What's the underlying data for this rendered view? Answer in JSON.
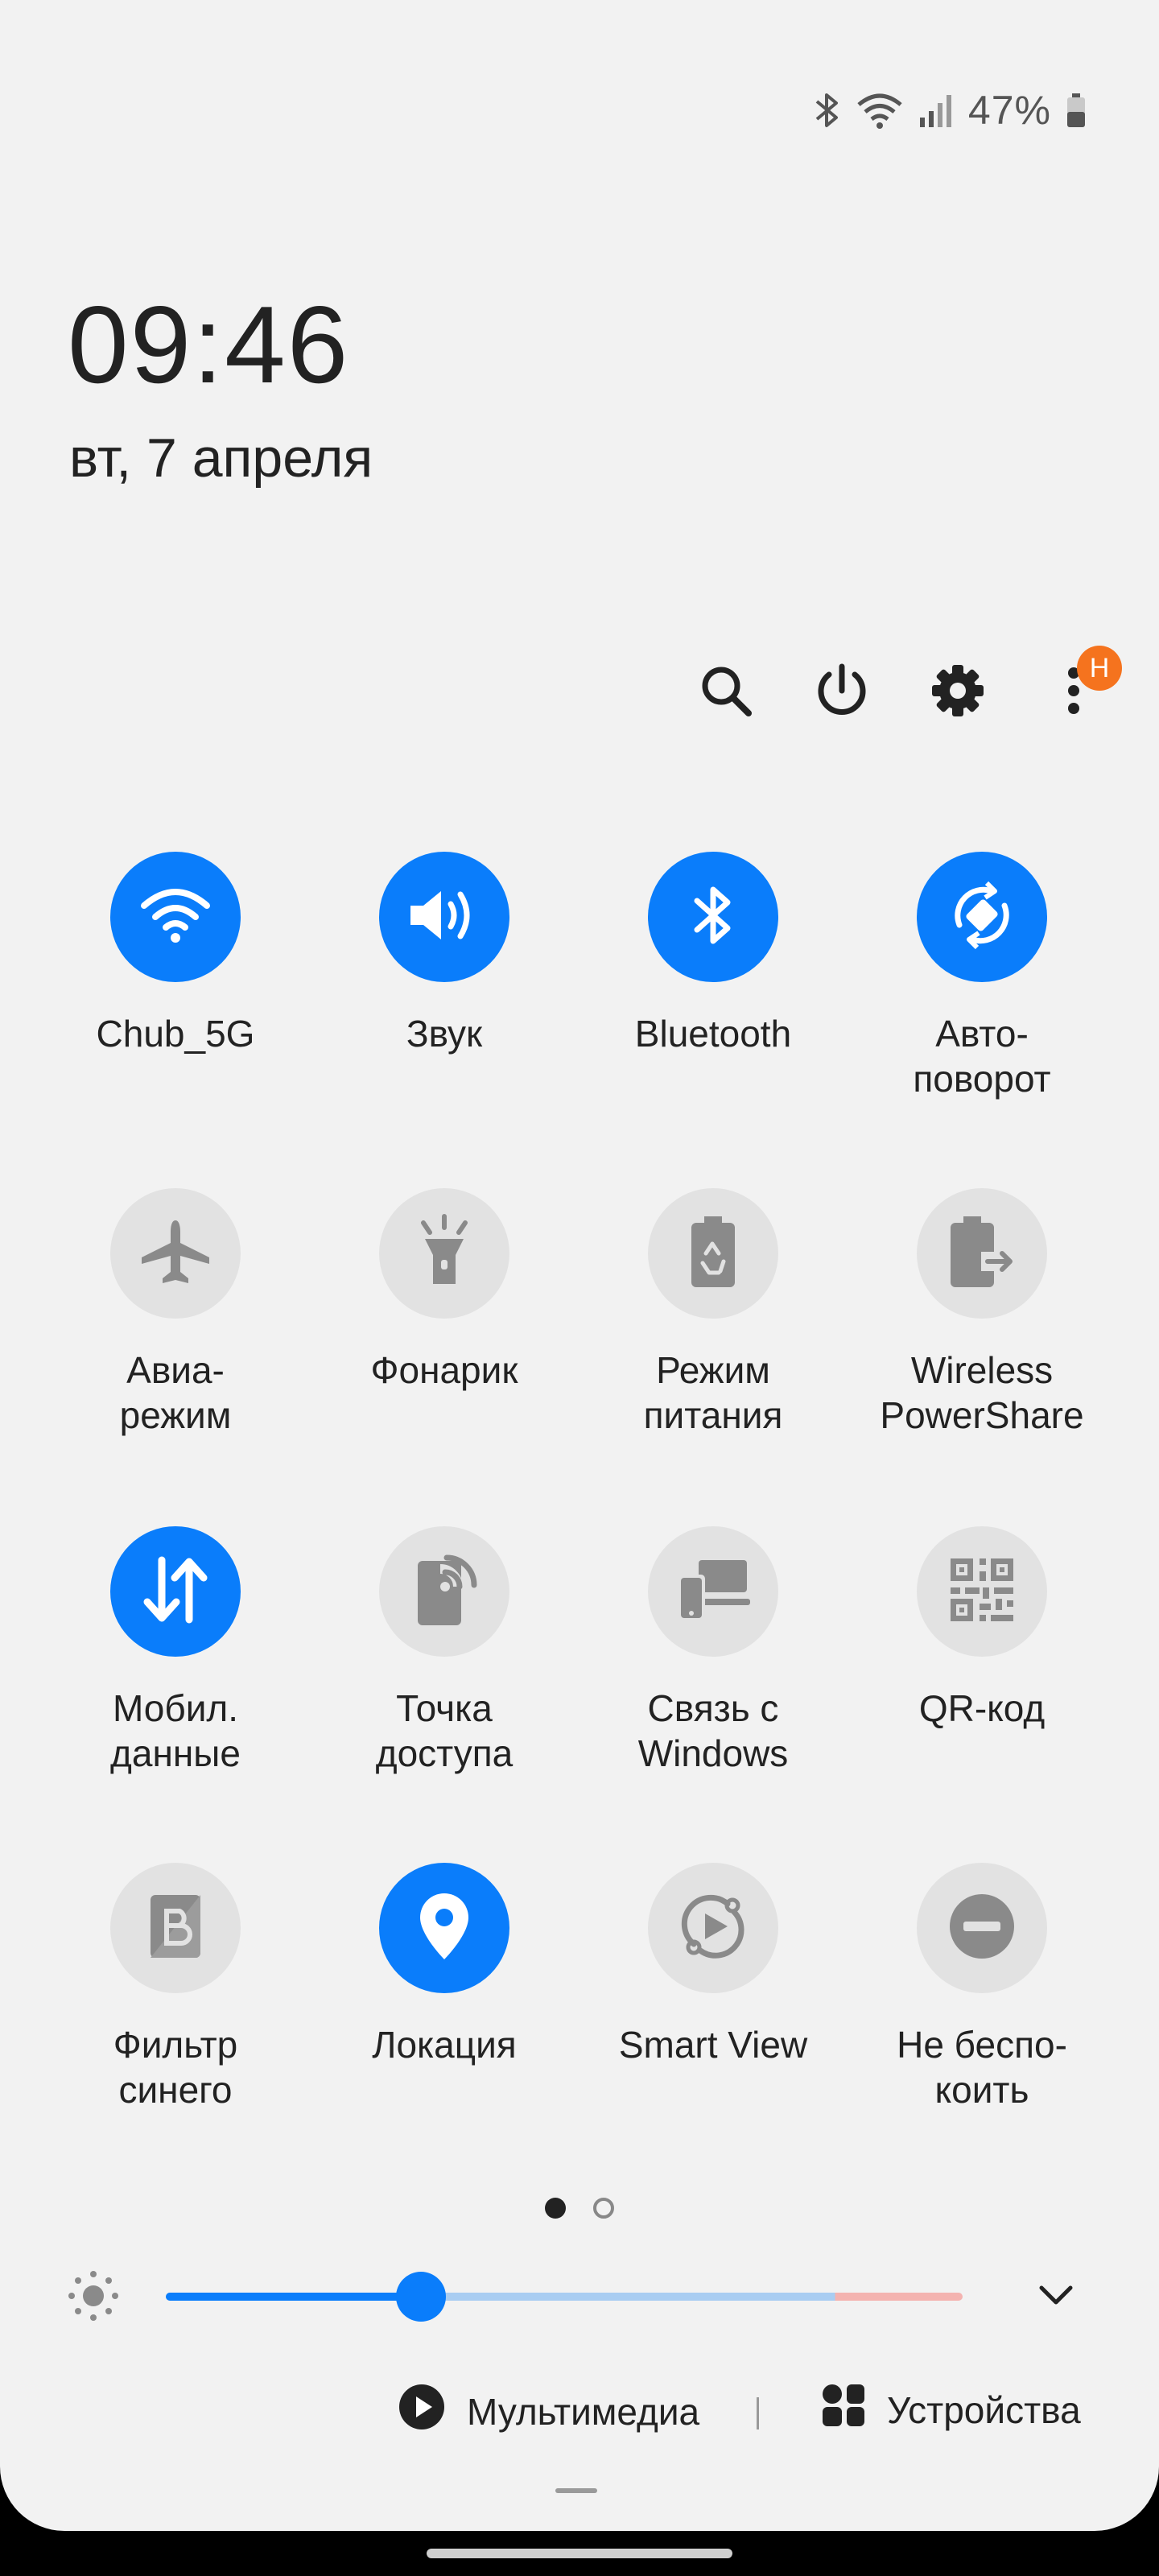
{
  "status": {
    "battery_percent": "47%"
  },
  "clock": {
    "time": "09:46",
    "date": "вт, 7 апреля"
  },
  "header": {
    "search_icon": "search-icon",
    "power_icon": "power-icon",
    "settings_icon": "gear-icon",
    "more_icon": "more-vertical-icon",
    "badge": "Н"
  },
  "tiles": [
    {
      "label": "Chub_5G",
      "state": "on",
      "icon": "wifi-icon"
    },
    {
      "label": "Звук",
      "state": "on",
      "icon": "sound-icon"
    },
    {
      "label": "Bluetooth",
      "state": "on",
      "icon": "bluetooth-icon"
    },
    {
      "label": "Авто-\nповорот",
      "state": "on",
      "icon": "auto-rotate-icon"
    },
    {
      "label": "Авиа-\nрежим",
      "state": "off",
      "icon": "airplane-icon"
    },
    {
      "label": "Фонарик",
      "state": "off",
      "icon": "flashlight-icon"
    },
    {
      "label": "Режим\nпитания",
      "state": "off",
      "icon": "power-mode-icon"
    },
    {
      "label": "Wireless\nPowerShare",
      "state": "off",
      "icon": "powershare-icon"
    },
    {
      "label": "Мобил.\nданные",
      "state": "on",
      "icon": "mobile-data-icon"
    },
    {
      "label": "Точка\nдоступа",
      "state": "off",
      "icon": "hotspot-icon"
    },
    {
      "label": "Связь с\nWindows",
      "state": "off",
      "icon": "link-windows-icon"
    },
    {
      "label": "QR-код",
      "state": "off",
      "icon": "qr-code-icon"
    },
    {
      "label": "Фильтр\nсинего",
      "state": "off",
      "icon": "blue-filter-icon"
    },
    {
      "label": "Локация",
      "state": "on",
      "icon": "location-icon"
    },
    {
      "label": "Smart View",
      "state": "off",
      "icon": "smart-view-icon"
    },
    {
      "label": "Не беспо-\nкоить",
      "state": "off",
      "icon": "do-not-disturb-icon"
    }
  ],
  "pager": {
    "current_page": 1,
    "total_pages": 2
  },
  "brightness": {
    "level": 0.32
  },
  "bottom": {
    "media_label": "Мультимедиа",
    "devices_label": "Устройства"
  },
  "colors": {
    "accent": "#0a7dfb",
    "badge": "#f5731e",
    "panel_bg": "#f2f2f2"
  }
}
